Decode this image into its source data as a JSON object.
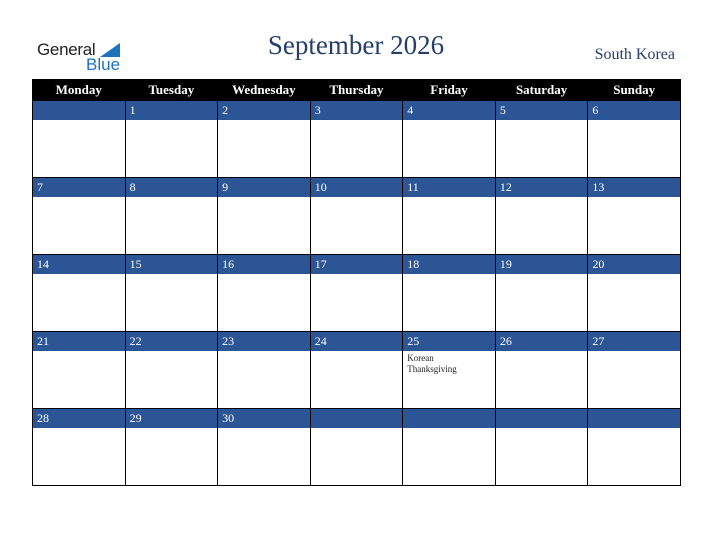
{
  "logo": {
    "line1": "General",
    "line2": "Blue",
    "brand_color": "#1e73be"
  },
  "header": {
    "title": "September 2026",
    "country": "South Korea"
  },
  "colors": {
    "day_bar": "#2c5595",
    "header_bg": "#000000",
    "title": "#253f6b"
  },
  "weekdays": [
    "Monday",
    "Tuesday",
    "Wednesday",
    "Thursday",
    "Friday",
    "Saturday",
    "Sunday"
  ],
  "weeks": [
    [
      {
        "day": ""
      },
      {
        "day": "1"
      },
      {
        "day": "2"
      },
      {
        "day": "3"
      },
      {
        "day": "4"
      },
      {
        "day": "5"
      },
      {
        "day": "6"
      }
    ],
    [
      {
        "day": "7"
      },
      {
        "day": "8"
      },
      {
        "day": "9"
      },
      {
        "day": "10"
      },
      {
        "day": "11"
      },
      {
        "day": "12"
      },
      {
        "day": "13"
      }
    ],
    [
      {
        "day": "14"
      },
      {
        "day": "15"
      },
      {
        "day": "16"
      },
      {
        "day": "17"
      },
      {
        "day": "18"
      },
      {
        "day": "19"
      },
      {
        "day": "20"
      }
    ],
    [
      {
        "day": "21"
      },
      {
        "day": "22"
      },
      {
        "day": "23"
      },
      {
        "day": "24"
      },
      {
        "day": "25",
        "event": "Korean Thanksgiving"
      },
      {
        "day": "26"
      },
      {
        "day": "27"
      }
    ],
    [
      {
        "day": "28"
      },
      {
        "day": "29"
      },
      {
        "day": "30"
      },
      {
        "day": ""
      },
      {
        "day": ""
      },
      {
        "day": ""
      },
      {
        "day": ""
      }
    ]
  ]
}
